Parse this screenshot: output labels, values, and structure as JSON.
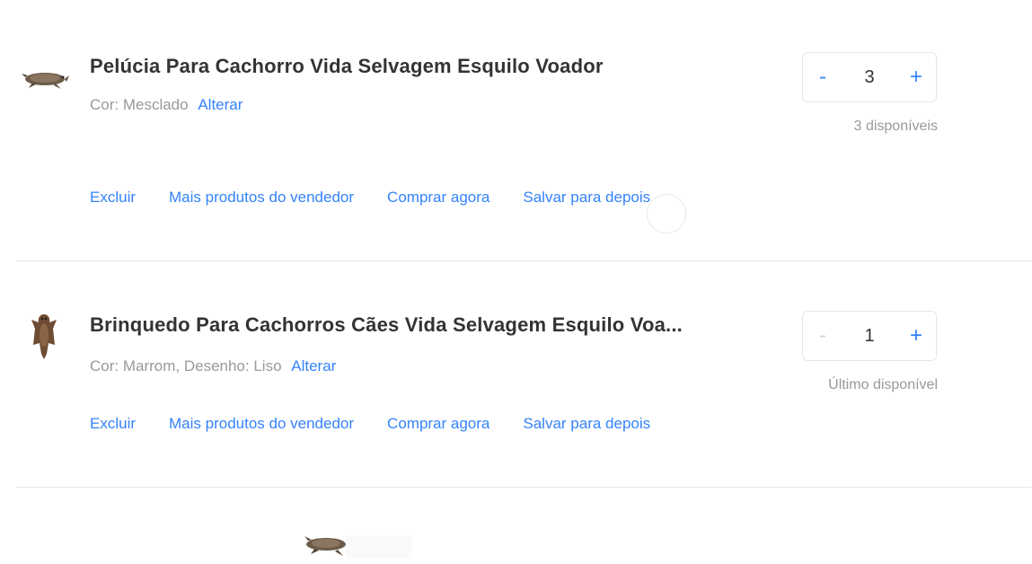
{
  "cart": {
    "items": [
      {
        "title": "Pelúcia Para Cachorro Vida Selvagem Esquilo Voador",
        "variant": "Cor: Mesclado",
        "change_label": "Alterar",
        "quantity": "3",
        "decrement_label": "-",
        "increment_label": "+",
        "availability": "3 disponíveis",
        "actions": {
          "delete": "Excluir",
          "seller_products": "Mais produtos do vendedor",
          "buy_now": "Comprar agora",
          "save_for_later": "Salvar para depois"
        }
      },
      {
        "title": "Brinquedo Para Cachorros Cães Vida Selvagem Esquilo Voa...",
        "variant": "Cor: Marrom, Desenho: Liso",
        "change_label": "Alterar",
        "quantity": "1",
        "decrement_label": "-",
        "increment_label": "+",
        "availability": "Último disponível",
        "actions": {
          "delete": "Excluir",
          "seller_products": "Mais produtos do vendedor",
          "buy_now": "Comprar agora",
          "save_for_later": "Salvar para depois"
        }
      }
    ]
  },
  "colors": {
    "link": "#3483fa",
    "text": "#333333",
    "muted": "#999999",
    "border": "#e6e6e6"
  },
  "icons": {
    "item_1_image": "flying-squirrel-plush",
    "item_2_image": "flying-squirrel-toy",
    "drag_preview": "flying-squirrel-plush",
    "loading": "loading-spinner-icon"
  }
}
